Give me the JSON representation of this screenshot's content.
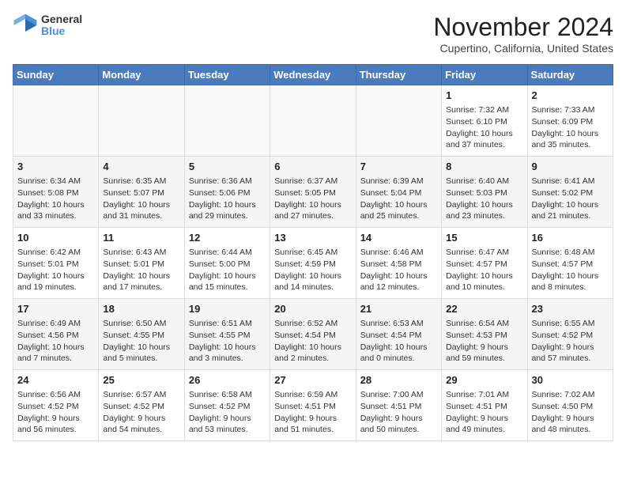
{
  "logo": {
    "general": "General",
    "blue": "Blue"
  },
  "title": "November 2024",
  "location": "Cupertino, California, United States",
  "weekdays": [
    "Sunday",
    "Monday",
    "Tuesday",
    "Wednesday",
    "Thursday",
    "Friday",
    "Saturday"
  ],
  "rows": [
    [
      {
        "day": "",
        "info": ""
      },
      {
        "day": "",
        "info": ""
      },
      {
        "day": "",
        "info": ""
      },
      {
        "day": "",
        "info": ""
      },
      {
        "day": "",
        "info": ""
      },
      {
        "day": "1",
        "info": "Sunrise: 7:32 AM\nSunset: 6:10 PM\nDaylight: 10 hours\nand 37 minutes."
      },
      {
        "day": "2",
        "info": "Sunrise: 7:33 AM\nSunset: 6:09 PM\nDaylight: 10 hours\nand 35 minutes."
      }
    ],
    [
      {
        "day": "3",
        "info": "Sunrise: 6:34 AM\nSunset: 5:08 PM\nDaylight: 10 hours\nand 33 minutes."
      },
      {
        "day": "4",
        "info": "Sunrise: 6:35 AM\nSunset: 5:07 PM\nDaylight: 10 hours\nand 31 minutes."
      },
      {
        "day": "5",
        "info": "Sunrise: 6:36 AM\nSunset: 5:06 PM\nDaylight: 10 hours\nand 29 minutes."
      },
      {
        "day": "6",
        "info": "Sunrise: 6:37 AM\nSunset: 5:05 PM\nDaylight: 10 hours\nand 27 minutes."
      },
      {
        "day": "7",
        "info": "Sunrise: 6:39 AM\nSunset: 5:04 PM\nDaylight: 10 hours\nand 25 minutes."
      },
      {
        "day": "8",
        "info": "Sunrise: 6:40 AM\nSunset: 5:03 PM\nDaylight: 10 hours\nand 23 minutes."
      },
      {
        "day": "9",
        "info": "Sunrise: 6:41 AM\nSunset: 5:02 PM\nDaylight: 10 hours\nand 21 minutes."
      }
    ],
    [
      {
        "day": "10",
        "info": "Sunrise: 6:42 AM\nSunset: 5:01 PM\nDaylight: 10 hours\nand 19 minutes."
      },
      {
        "day": "11",
        "info": "Sunrise: 6:43 AM\nSunset: 5:01 PM\nDaylight: 10 hours\nand 17 minutes."
      },
      {
        "day": "12",
        "info": "Sunrise: 6:44 AM\nSunset: 5:00 PM\nDaylight: 10 hours\nand 15 minutes."
      },
      {
        "day": "13",
        "info": "Sunrise: 6:45 AM\nSunset: 4:59 PM\nDaylight: 10 hours\nand 14 minutes."
      },
      {
        "day": "14",
        "info": "Sunrise: 6:46 AM\nSunset: 4:58 PM\nDaylight: 10 hours\nand 12 minutes."
      },
      {
        "day": "15",
        "info": "Sunrise: 6:47 AM\nSunset: 4:57 PM\nDaylight: 10 hours\nand 10 minutes."
      },
      {
        "day": "16",
        "info": "Sunrise: 6:48 AM\nSunset: 4:57 PM\nDaylight: 10 hours\nand 8 minutes."
      }
    ],
    [
      {
        "day": "17",
        "info": "Sunrise: 6:49 AM\nSunset: 4:56 PM\nDaylight: 10 hours\nand 7 minutes."
      },
      {
        "day": "18",
        "info": "Sunrise: 6:50 AM\nSunset: 4:55 PM\nDaylight: 10 hours\nand 5 minutes."
      },
      {
        "day": "19",
        "info": "Sunrise: 6:51 AM\nSunset: 4:55 PM\nDaylight: 10 hours\nand 3 minutes."
      },
      {
        "day": "20",
        "info": "Sunrise: 6:52 AM\nSunset: 4:54 PM\nDaylight: 10 hours\nand 2 minutes."
      },
      {
        "day": "21",
        "info": "Sunrise: 6:53 AM\nSunset: 4:54 PM\nDaylight: 10 hours\nand 0 minutes."
      },
      {
        "day": "22",
        "info": "Sunrise: 6:54 AM\nSunset: 4:53 PM\nDaylight: 9 hours\nand 59 minutes."
      },
      {
        "day": "23",
        "info": "Sunrise: 6:55 AM\nSunset: 4:52 PM\nDaylight: 9 hours\nand 57 minutes."
      }
    ],
    [
      {
        "day": "24",
        "info": "Sunrise: 6:56 AM\nSunset: 4:52 PM\nDaylight: 9 hours\nand 56 minutes."
      },
      {
        "day": "25",
        "info": "Sunrise: 6:57 AM\nSunset: 4:52 PM\nDaylight: 9 hours\nand 54 minutes."
      },
      {
        "day": "26",
        "info": "Sunrise: 6:58 AM\nSunset: 4:52 PM\nDaylight: 9 hours\nand 53 minutes."
      },
      {
        "day": "27",
        "info": "Sunrise: 6:59 AM\nSunset: 4:51 PM\nDaylight: 9 hours\nand 51 minutes."
      },
      {
        "day": "28",
        "info": "Sunrise: 7:00 AM\nSunset: 4:51 PM\nDaylight: 9 hours\nand 50 minutes."
      },
      {
        "day": "29",
        "info": "Sunrise: 7:01 AM\nSunset: 4:51 PM\nDaylight: 9 hours\nand 49 minutes."
      },
      {
        "day": "30",
        "info": "Sunrise: 7:02 AM\nSunset: 4:50 PM\nDaylight: 9 hours\nand 48 minutes."
      }
    ]
  ]
}
